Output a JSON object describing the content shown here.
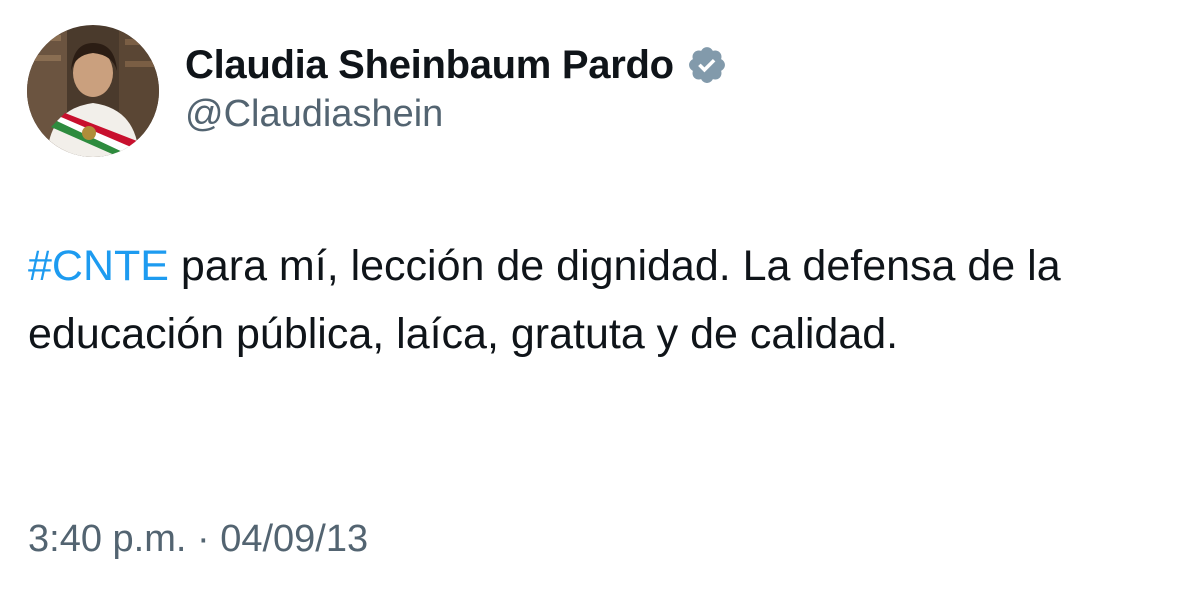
{
  "author": {
    "display_name": "Claudia Sheinbaum Pardo",
    "handle": "@Claudiashein",
    "verified": true,
    "avatar_icon": "profile-photo-avatar",
    "badge_icon": "verified-badge-icon",
    "badge_color": "#829aab"
  },
  "tweet": {
    "hashtag": "#CNTE",
    "body": " para mí, lección de dignidad. La defensa de la educación pública, laíca, gratuta y de calidad.",
    "hashtag_color": "#1d9bf0"
  },
  "meta": {
    "time": "3:40 p.m.",
    "separator": "·",
    "date": "04/09/13"
  }
}
